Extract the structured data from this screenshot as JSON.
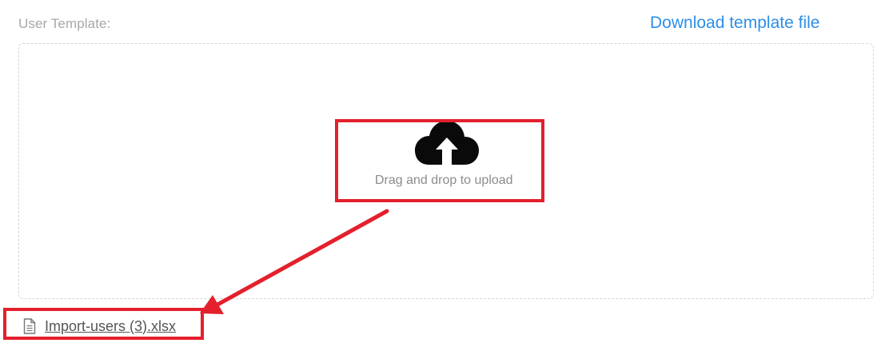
{
  "form": {
    "label": "User Template:",
    "download_link": "Download template file"
  },
  "dropzone": {
    "icon": "cloud-upload-icon",
    "text": "Drag and drop to upload"
  },
  "uploaded_file": {
    "icon": "document-icon",
    "name": "Import-users (3).xlsx"
  },
  "annotation": {
    "color": "#e3202c"
  },
  "colors": {
    "link": "#2d8ee8",
    "label": "#a8a8a8"
  }
}
